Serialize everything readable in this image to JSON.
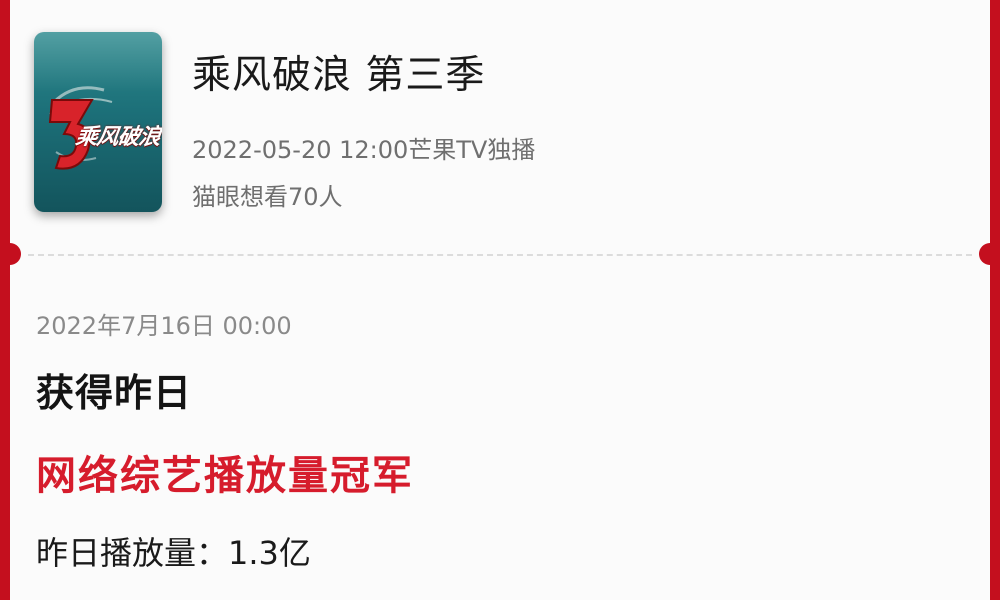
{
  "show": {
    "title": "乘风破浪 第三季",
    "release": "2022-05-20 12:00芒果TV独播",
    "wish_count": "猫眼想看70人",
    "poster_logo_text": "乘风破浪",
    "poster_logo_numeral": "3"
  },
  "notice": {
    "timestamp": "2022年7月16日 00:00",
    "headline": "获得昨日",
    "award": "网络综艺播放量冠军",
    "plays_line": "昨日播放量：1.3亿"
  },
  "colors": {
    "frame_red": "#c40f1e",
    "award_red": "#d61c2c",
    "poster_teal": "#1c6f78"
  }
}
